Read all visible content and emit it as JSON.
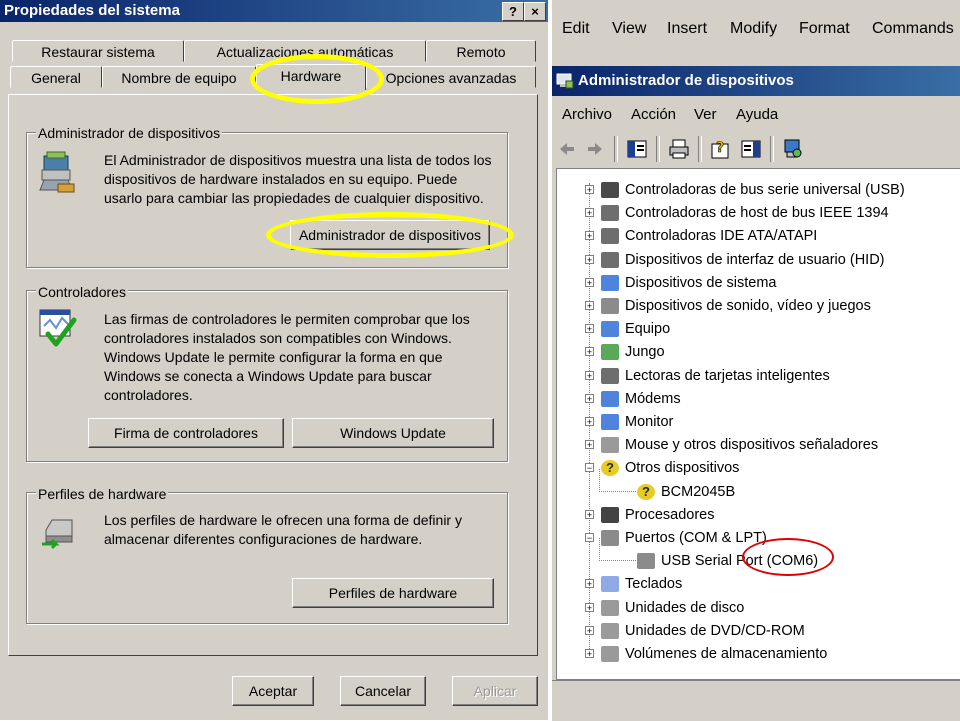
{
  "system_properties": {
    "title": "Propiedades del sistema",
    "help_button": "?",
    "close_button": "×",
    "tabs_row1": [
      "Restaurar sistema",
      "Actualizaciones automáticas",
      "Remoto"
    ],
    "tabs_row2": [
      "General",
      "Nombre de equipo",
      "Hardware",
      "Opciones avanzadas"
    ],
    "active_tab": "Hardware",
    "device_manager_group": {
      "label": "Administrador de dispositivos",
      "lines": [
        "El Administrador de dispositivos muestra una lista de todos los",
        "dispositivos de hardware instalados en su equipo. Puede",
        "usarlo para cambiar las propiedades de cualquier dispositivo."
      ],
      "button": "Administrador de dispositivos"
    },
    "drivers_group": {
      "label": "Controladores",
      "lines": [
        "Las firmas de controladores le permiten comprobar que los",
        "controladores instalados son compatibles con Windows.",
        "Windows Update le permite configurar la forma en que",
        "Windows se conecta a Windows Update para buscar",
        "controladores."
      ],
      "button_signing": "Firma de controladores",
      "button_update": "Windows Update"
    },
    "profiles_group": {
      "label": "Perfiles de hardware",
      "lines": [
        "Los perfiles de hardware le ofrecen una forma de definir y",
        "almacenar diferentes configuraciones de hardware."
      ],
      "button": "Perfiles de hardware"
    },
    "footer": {
      "ok": "Aceptar",
      "cancel": "Cancelar",
      "apply": "Aplicar"
    }
  },
  "top_menu": [
    "Edit",
    "View",
    "Insert",
    "Modify",
    "Format",
    "Commands"
  ],
  "device_manager": {
    "title": "Administrador de dispositivos",
    "menu": [
      "Archivo",
      "Acción",
      "Ver",
      "Ayuda"
    ],
    "tree": [
      "Controladoras de bus serie universal (USB)",
      "Controladoras de host de bus IEEE 1394",
      "Controladoras IDE ATA/ATAPI",
      "Dispositivos de interfaz de usuario (HID)",
      "Dispositivos de sistema",
      "Dispositivos de sonido, vídeo y juegos",
      "Equipo",
      "Jungo",
      "Lectoras de tarjetas inteligentes",
      "Módems",
      "Monitor",
      "Mouse y otros dispositivos señaladores",
      "Otros dispositivos",
      "BCM2045B",
      "Procesadores",
      "Puertos (COM & LPT)",
      "USB Serial Port (COM6)",
      "Teclados",
      "Unidades de disco",
      "Unidades de DVD/CD-ROM",
      "Volúmenes de almacenamiento"
    ]
  },
  "colors": {
    "dialog_face": "#d4d0c8",
    "title_active": "#0a246a",
    "highlight_yellow": "#ffff00",
    "highlight_red": "#e00000"
  }
}
